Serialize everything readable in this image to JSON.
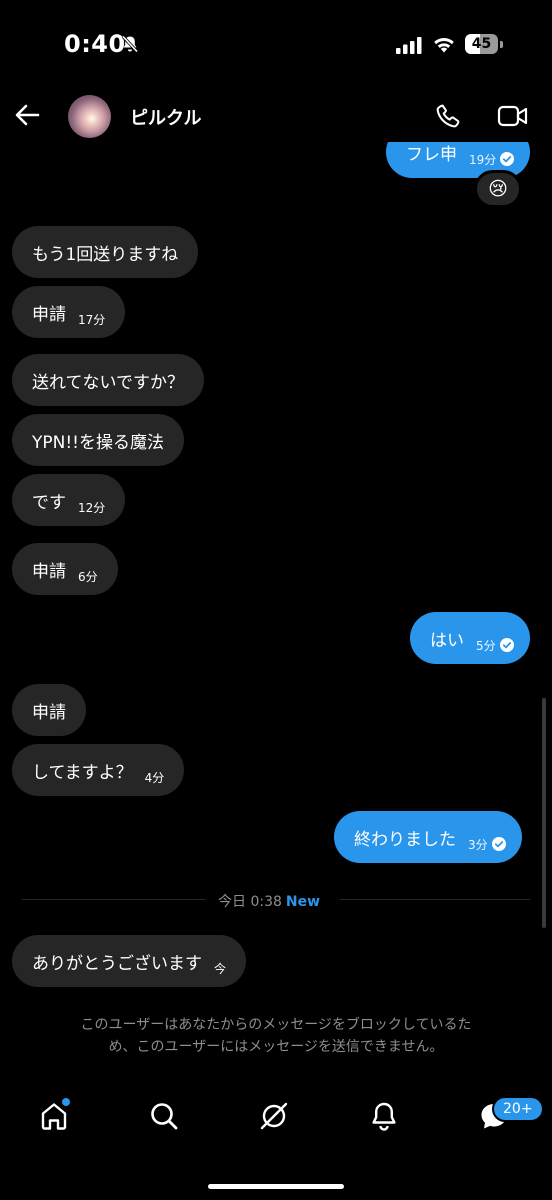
{
  "status_bar": {
    "time": "0:40",
    "battery": "45"
  },
  "header": {
    "contact_name": "ピルクル"
  },
  "messages": [
    {
      "direction": "out",
      "text": "フレ申",
      "time": "19分",
      "reaction": "😢"
    },
    {
      "direction": "in",
      "text": "もう1回送りますね",
      "time": ""
    },
    {
      "direction": "in",
      "text": "申請",
      "time": "17分"
    },
    {
      "direction": "in",
      "text": "送れてないですか？",
      "time": ""
    },
    {
      "direction": "in",
      "text": "YPN!!を操る魔法",
      "time": ""
    },
    {
      "direction": "in",
      "text": "です",
      "time": "12分"
    },
    {
      "direction": "in",
      "text": "申請",
      "time": "6分"
    },
    {
      "direction": "out",
      "text": "はい",
      "time": "5分"
    },
    {
      "direction": "in",
      "text": "申請",
      "time": ""
    },
    {
      "direction": "in",
      "text": "してますよ？",
      "time": "4分"
    },
    {
      "direction": "out",
      "text": "終わりました",
      "time": "3分"
    },
    {
      "direction": "in",
      "text": "ありがとうございます",
      "time": "今"
    }
  ],
  "divider": {
    "text": "今日 0:38",
    "new_label": "New"
  },
  "notice": {
    "line1": "このユーザーはあなたからのメッセージをブロックしているた",
    "line2": "め、このユーザーにはメッセージを送信できません。"
  },
  "bottom_nav": {
    "items": [
      "home-icon",
      "search-icon",
      "explore-icon",
      "notifications-icon",
      "messages-icon"
    ],
    "messages_badge": "20+"
  },
  "colors": {
    "accent": "#2a96eb",
    "incoming_bubble": "#262626",
    "background": "#000000"
  }
}
